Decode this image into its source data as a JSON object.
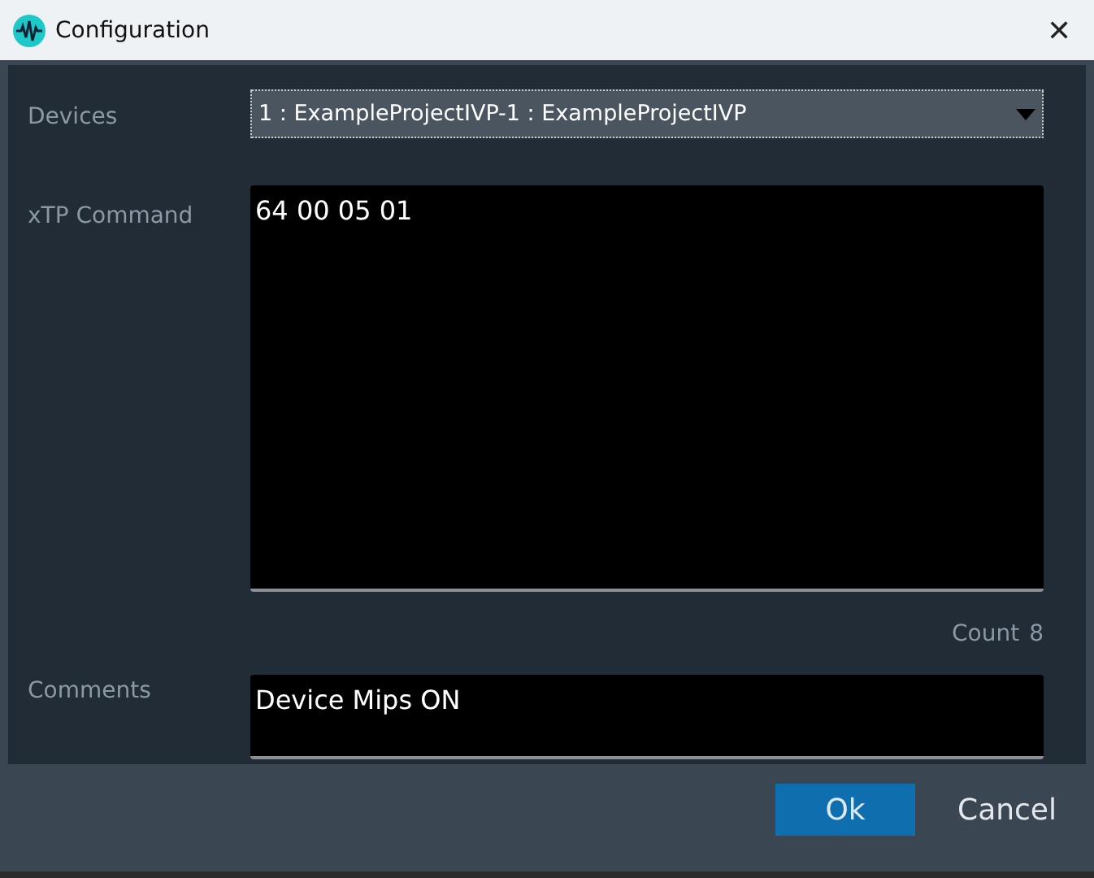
{
  "window": {
    "title": "Configuration",
    "close": "✕"
  },
  "devices": {
    "label": "Devices",
    "value": "1 : ExampleProjectIVP-1 : ExampleProjectIVP"
  },
  "command": {
    "label": "xTP Command",
    "value": "64 00 05 01",
    "count_label": "Count",
    "count": "8"
  },
  "comments": {
    "label": "Comments",
    "value": "Device Mips ON"
  },
  "buttons": [
    {
      "label": "Ok",
      "kind": "primary"
    },
    {
      "label": "Cancel",
      "kind": "plain"
    }
  ]
}
